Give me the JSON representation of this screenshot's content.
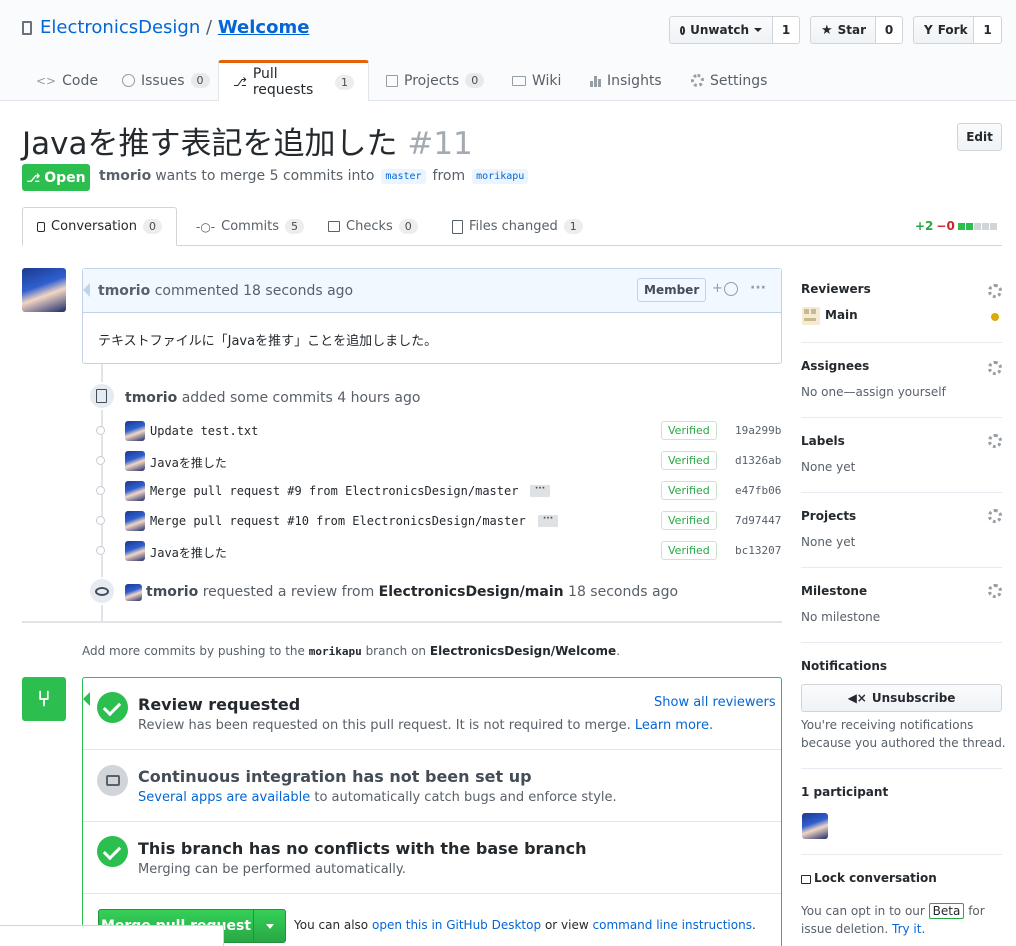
{
  "repo": {
    "owner": "ElectronicsDesign",
    "separator": "/",
    "name": "Welcome"
  },
  "actions": {
    "unwatch": "Unwatch",
    "unwatch_count": "1",
    "star": "Star",
    "star_count": "0",
    "fork": "Fork",
    "fork_count": "1"
  },
  "tabs": [
    {
      "label": "Code",
      "count": ""
    },
    {
      "label": "Issues",
      "count": "0"
    },
    {
      "label": "Pull requests",
      "count": "1"
    },
    {
      "label": "Projects",
      "count": "0"
    },
    {
      "label": "Wiki",
      "count": ""
    },
    {
      "label": "Insights",
      "count": ""
    },
    {
      "label": "Settings",
      "count": ""
    }
  ],
  "pr": {
    "title": "Javaを推す表記を追加した",
    "number": "#11",
    "edit": "Edit",
    "state": "Open",
    "author": "tmorio",
    "meta_text": "wants to merge 5 commits into",
    "base": "master",
    "from": "from",
    "head": "morikapu"
  },
  "subtabs": [
    {
      "label": "Conversation",
      "count": "0"
    },
    {
      "label": "Commits",
      "count": "5"
    },
    {
      "label": "Checks",
      "count": "0"
    },
    {
      "label": "Files changed",
      "count": "1"
    }
  ],
  "diffstat": {
    "add": "+2",
    "del": "−0"
  },
  "comment": {
    "author": "tmorio",
    "time": "commented 18 seconds ago",
    "badge": "Member",
    "reaction": "+",
    "more": "···",
    "body": "テキストファイルに「Javaを推す」ことを追加しました。"
  },
  "commits_event": {
    "author": "tmorio",
    "text": "added some commits 4 hours ago"
  },
  "commits": [
    {
      "message": "Update test.txt",
      "verified": "Verified",
      "sha": "19a299b",
      "ellipsis": ""
    },
    {
      "message": "Javaを推した",
      "verified": "Verified",
      "sha": "d1326ab",
      "ellipsis": ""
    },
    {
      "message": "Merge pull request #9 from ElectronicsDesign/master",
      "verified": "Verified",
      "sha": "e47fb06",
      "ellipsis": "···"
    },
    {
      "message": "Merge pull request #10 from ElectronicsDesign/master",
      "verified": "Verified",
      "sha": "7d97447",
      "ellipsis": "···"
    },
    {
      "message": "Javaを推した",
      "verified": "Verified",
      "sha": "bc13207",
      "ellipsis": ""
    }
  ],
  "review_event": {
    "author": "tmorio",
    "text": "requested a review from",
    "team": "ElectronicsDesign/main",
    "time": "18 seconds ago"
  },
  "push_hint": {
    "prefix": "Add more commits by pushing to the",
    "branch": "morikapu",
    "middle": "branch on",
    "repo": "ElectronicsDesign/Welcome",
    "suffix": "."
  },
  "merge_box": {
    "review_title": "Review requested",
    "review_link": "Show all reviewers",
    "review_desc": "Review has been requested on this pull request. It is not required to merge.",
    "review_learn": "Learn more.",
    "ci_title": "Continuous integration has not been set up",
    "ci_link": "Several apps are available",
    "ci_desc": "to automatically catch bugs and enforce style.",
    "conflict_title": "This branch has no conflicts with the base branch",
    "conflict_desc": "Merging can be performed automatically.",
    "merge_button": "Merge pull request",
    "also": "You can also",
    "desktop_link": "open this in GitHub Desktop",
    "or_view": "or view",
    "cli_link": "command line instructions",
    "period": "."
  },
  "sidebar": {
    "reviewers_label": "Reviewers",
    "reviewer": "Main",
    "assignees_label": "Assignees",
    "assignees_value": "No one—assign yourself",
    "labels_label": "Labels",
    "labels_value": "None yet",
    "projects_label": "Projects",
    "projects_value": "None yet",
    "milestone_label": "Milestone",
    "milestone_value": "No milestone",
    "notifications_label": "Notifications",
    "unsubscribe": "Unsubscribe",
    "notif_desc_1": "You're receiving notifications",
    "notif_desc_2": "because you authored the thread.",
    "participants": "1 participant",
    "lock": "Lock conversation",
    "beta_1": "You can opt in to our",
    "beta_badge": "Beta",
    "beta_2": "for",
    "beta_3": "issue deletion.",
    "beta_link": "Try it."
  },
  "colors": {
    "accent": "#0366d6",
    "open": "#2cbe4e",
    "tab_active": "#e36209",
    "merge": "#28a745"
  }
}
